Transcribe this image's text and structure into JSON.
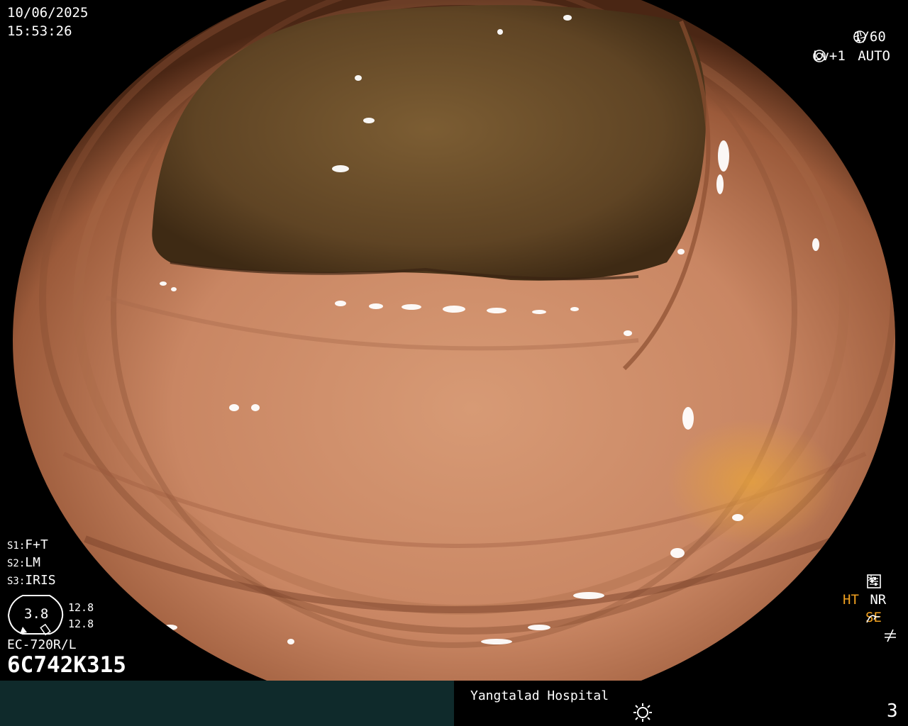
{
  "header": {
    "date": "10/06/2025",
    "time": "15:53:26"
  },
  "top_right": {
    "shutter": "1/60",
    "shutter_icon": "aperture-icon",
    "level": "Lv+1",
    "mode": "AUTO",
    "mode_icon": "auto-iris-icon"
  },
  "switches": {
    "s1": {
      "key": "S1",
      "value": "F+T"
    },
    "s2": {
      "key": "S2",
      "value": "LM"
    },
    "s3": {
      "key": "S3",
      "value": "IRIS"
    }
  },
  "gauge": {
    "center_value": "3.8",
    "upper_value": "12.8",
    "lower_value": "12.8"
  },
  "scope": {
    "model": "EC-720R/L",
    "serial": "6C742K315"
  },
  "indicators": {
    "asterisk": "*",
    "ht": "HT",
    "nr": "NR",
    "se": "SE",
    "ht_color": "#f0a020",
    "se_color": "#f0a020"
  },
  "footer": {
    "hospital": "Yangtalad Hospital",
    "sun_icon": "sun-icon",
    "page": "3"
  }
}
